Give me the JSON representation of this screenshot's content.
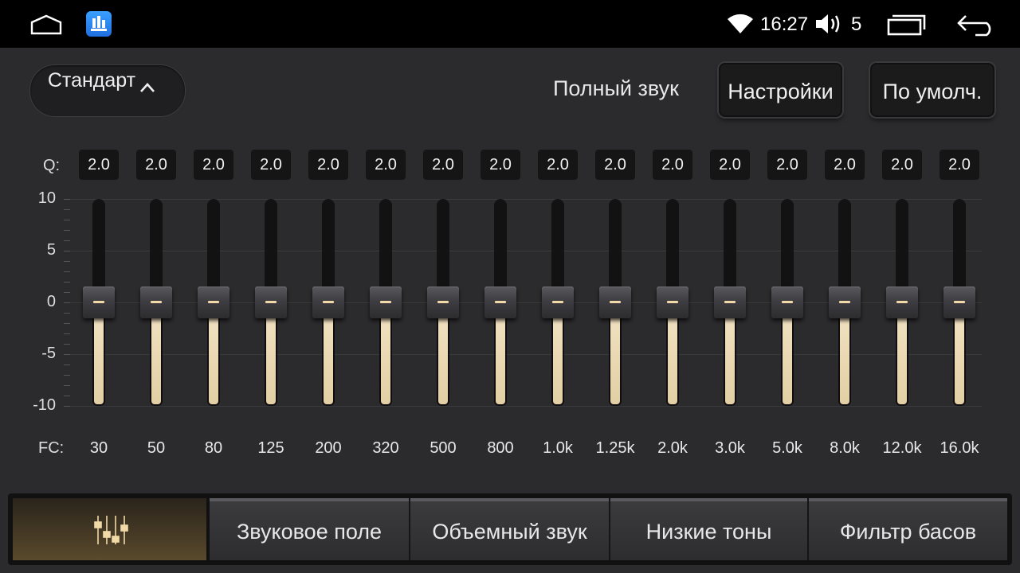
{
  "status_bar": {
    "time": "16:27",
    "volume": "5"
  },
  "preset": {
    "label": "Стандарт"
  },
  "header": {
    "full_sound_label": "Полный звук",
    "settings_label": "Настройки",
    "default_label": "По умолч."
  },
  "eq": {
    "q_label": "Q:",
    "fc_label": "FC:",
    "y_ticks": [
      "10",
      "5",
      "0",
      "-5",
      "-10"
    ],
    "y_range": [
      -10,
      10
    ],
    "bands": [
      {
        "fc": "30",
        "q": "2.0",
        "gain": 0
      },
      {
        "fc": "50",
        "q": "2.0",
        "gain": 0
      },
      {
        "fc": "80",
        "q": "2.0",
        "gain": 0
      },
      {
        "fc": "125",
        "q": "2.0",
        "gain": 0
      },
      {
        "fc": "200",
        "q": "2.0",
        "gain": 0
      },
      {
        "fc": "320",
        "q": "2.0",
        "gain": 0
      },
      {
        "fc": "500",
        "q": "2.0",
        "gain": 0
      },
      {
        "fc": "800",
        "q": "2.0",
        "gain": 0
      },
      {
        "fc": "1.0k",
        "q": "2.0",
        "gain": 0
      },
      {
        "fc": "1.25k",
        "q": "2.0",
        "gain": 0
      },
      {
        "fc": "2.0k",
        "q": "2.0",
        "gain": 0
      },
      {
        "fc": "3.0k",
        "q": "2.0",
        "gain": 0
      },
      {
        "fc": "5.0k",
        "q": "2.0",
        "gain": 0
      },
      {
        "fc": "8.0k",
        "q": "2.0",
        "gain": 0
      },
      {
        "fc": "12.0k",
        "q": "2.0",
        "gain": 0
      },
      {
        "fc": "16.0k",
        "q": "2.0",
        "gain": 0
      }
    ]
  },
  "tabs": [
    {
      "id": "equalizer",
      "icon": "equalizer-icon",
      "active": true
    },
    {
      "id": "sound-field",
      "label": "Звуковое поле"
    },
    {
      "id": "surround",
      "label": "Объемный звук"
    },
    {
      "id": "bass",
      "label": "Низкие тоны"
    },
    {
      "id": "bass-filter",
      "label": "Фильтр басов"
    }
  ],
  "colors": {
    "accent": "#f2d9a8",
    "background": "#2b2b2d"
  }
}
